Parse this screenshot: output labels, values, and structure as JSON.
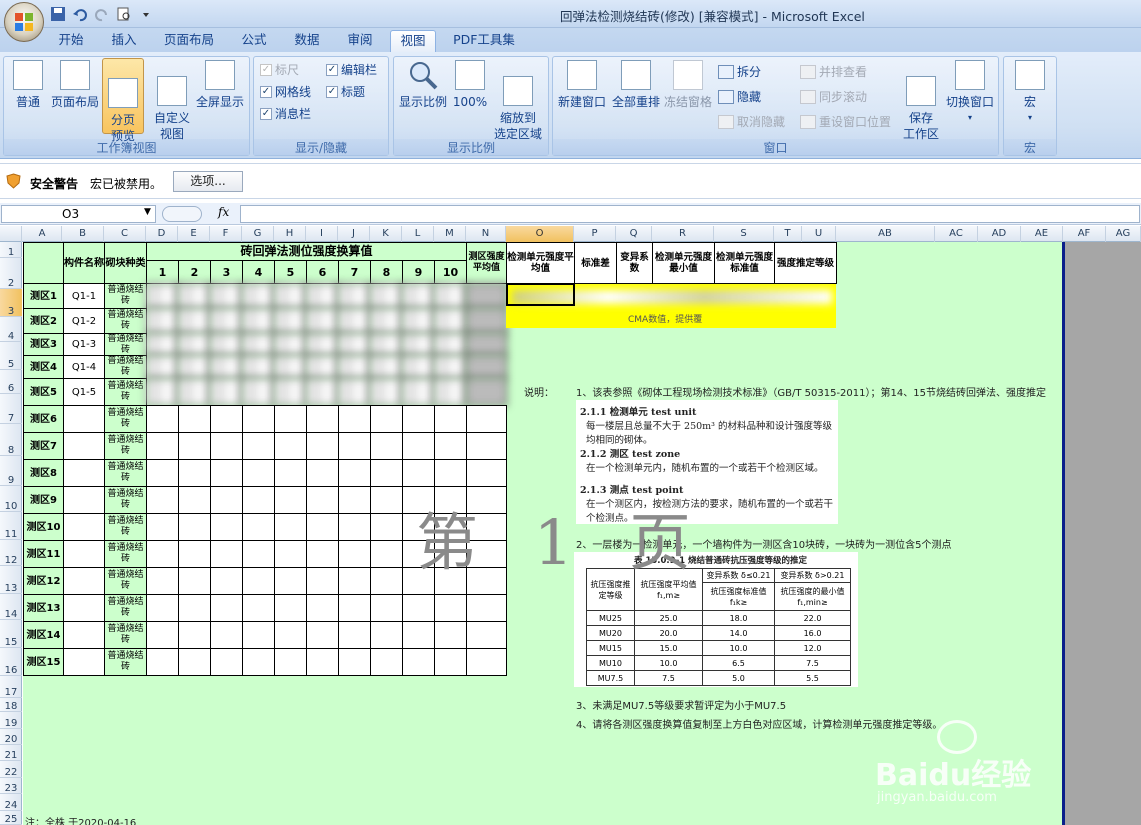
{
  "window": {
    "title": "回弹法检测烧结砖(修改)  [兼容模式] - Microsoft Excel"
  },
  "tabs": [
    "开始",
    "插入",
    "页面布局",
    "公式",
    "数据",
    "审阅",
    "视图",
    "PDF工具集"
  ],
  "active_tab": "视图",
  "ribbon": {
    "workbook_views": {
      "label": "工作簿视图",
      "normal": "普通",
      "page_layout": "页面布局",
      "page_break_preview": "分页\n预览",
      "custom_views": "自定义\n视图",
      "full_screen": "全屏显示"
    },
    "show_hide": {
      "label": "显示/隐藏",
      "ruler": "标尺",
      "gridlines": "网格线",
      "message_bar": "消息栏",
      "formula_bar": "编辑栏",
      "headings": "标题"
    },
    "zoom": {
      "label": "显示比例",
      "zoom": "显示比例",
      "zoom_100": "100%",
      "zoom_selection": "缩放到\n选定区域"
    },
    "window": {
      "label": "窗口",
      "new_window": "新建窗口",
      "arrange_all": "全部重排",
      "freeze_panes": "冻结窗格",
      "split": "拆分",
      "hide": "隐藏",
      "unhide": "取消隐藏",
      "view_side": "并排查看",
      "sync_scroll": "同步滚动",
      "reset_pos": "重设窗口位置",
      "save_workspace": "保存\n工作区",
      "switch_windows": "切换窗口"
    },
    "macros": {
      "label": "宏",
      "macros": "宏"
    }
  },
  "security": {
    "title": "安全警告",
    "message": "宏已被禁用。",
    "options": "选项..."
  },
  "namebox": "O3",
  "fx": "fx",
  "columns": [
    "A",
    "B",
    "C",
    "D",
    "E",
    "F",
    "G",
    "H",
    "I",
    "J",
    "K",
    "L",
    "M",
    "N",
    "O",
    "P",
    "Q",
    "R",
    "S",
    "T",
    "U",
    "AB",
    "AC",
    "AD",
    "AE",
    "AF",
    "AG"
  ],
  "rows": [
    "1",
    "2",
    "3",
    "4",
    "5",
    "6",
    "7",
    "8",
    "9",
    "10",
    "11",
    "12",
    "13",
    "14",
    "15",
    "16",
    "17",
    "18",
    "19",
    "20",
    "21",
    "22",
    "23",
    "24",
    "25",
    "26"
  ],
  "table": {
    "title": "砖回弹法测位强度换算值",
    "h_member": "构件名称",
    "h_type": "砌块种类",
    "h_avg": "测区强度平均值",
    "positions": [
      "1",
      "2",
      "3",
      "4",
      "5",
      "6",
      "7",
      "8",
      "9",
      "10"
    ],
    "zones": [
      "测区1",
      "测区2",
      "测区3",
      "测区4",
      "测区5",
      "测区6",
      "测区7",
      "测区8",
      "测区9",
      "测区10",
      "测区11",
      "测区12",
      "测区13",
      "测区14",
      "测区15"
    ],
    "members": [
      "Q1-1",
      "Q1-2",
      "Q1-3",
      "Q1-4",
      "Q1-5"
    ],
    "brick": "普通烧结砖"
  },
  "summary": {
    "h1": "检测单元强度平均值",
    "h2": "标准差",
    "h3": "变异系数",
    "h4": "检测单元强度最小值",
    "h5": "检测单元强度标准值",
    "h6": "强度推定等级",
    "note": "CMA数值，提供覆"
  },
  "notes": {
    "label": "说明：",
    "n1": "1、该表参照《砌体工程现场检测技术标准》（GB/T 50315-2011）；第14、15节烧结砖回弹法、强度推定",
    "n2": "2、一层楼为一检测单元，一个墙构件为一测区含10块砖，一块砖为一测位含5个测点",
    "n3": "3、未满足MU7.5等级要求暂评定为小于MU7.5",
    "n4": "4、请将各测区强度换算值复制至上方白色对应区域，计算检测单元强度推定等级。"
  },
  "definitions": {
    "d1": "2.1.1  检测单元   test unit",
    "d1b": "每一楼层且总量不大于 250m³ 的材料品种和设计强度等级均相同的砌体。",
    "d2": "2.1.2  测区   test zone",
    "d2b": "在一个检测单元内，随机布置的一个或若干个检测区域。",
    "d3": "2.1.3  测点   test point",
    "d3b": "在一个测区内，按检测方法的要求，随机布置的一个或若干个检测点。"
  },
  "std_table": {
    "caption": "表 15.0.9-1  烧结普通砖抗压强度等级的推定",
    "h_grade": "抗压强度推定等级",
    "h_mean": "抗压强度平均值 f₁,m≥",
    "h_dlow": "变异系数 δ≤0.21",
    "h_dhigh": "变异系数 δ>0.21",
    "h_std": "抗压强度标准值 f₁k≥",
    "h_min": "抗压强度的最小值 f₁,min≥",
    "rows": [
      [
        "MU25",
        "25.0",
        "18.0",
        "22.0"
      ],
      [
        "MU20",
        "20.0",
        "14.0",
        "16.0"
      ],
      [
        "MU15",
        "15.0",
        "10.0",
        "12.0"
      ],
      [
        "MU10",
        "10.0",
        "6.5",
        "7.5"
      ],
      [
        "MU7.5",
        "7.5",
        "5.0",
        "5.5"
      ]
    ]
  },
  "watermark": "第 1 页",
  "footer_note": "注：全株  于2020-04-16",
  "baidu": {
    "brand": "Baidu经验",
    "url": "jingyan.baidu.com"
  }
}
